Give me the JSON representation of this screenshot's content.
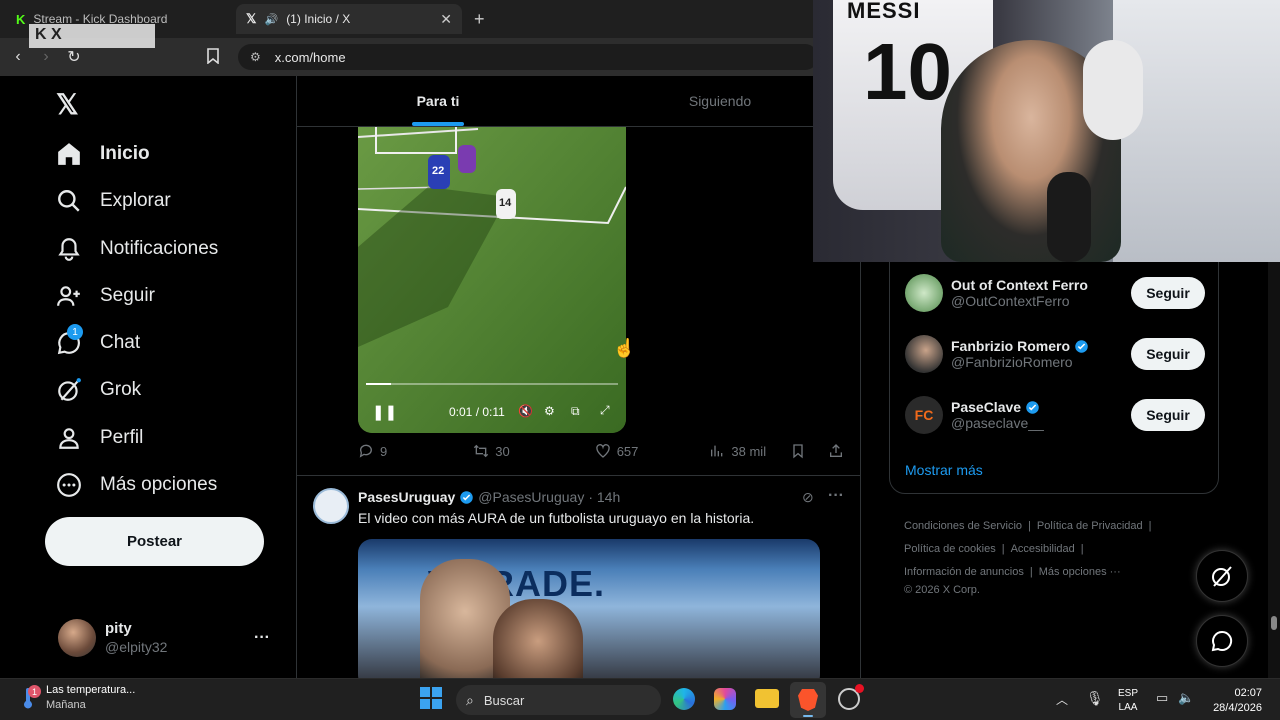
{
  "browser": {
    "tabs": [
      {
        "label": "Stream - Kick Dashboard"
      },
      {
        "label": "(1) Inicio / X"
      }
    ],
    "overlay_logo": "K X",
    "url": "x.com/home"
  },
  "sidebar": {
    "items": [
      {
        "label": "Inicio",
        "icon": "home-icon"
      },
      {
        "label": "Explorar",
        "icon": "search-icon"
      },
      {
        "label": "Notificaciones",
        "icon": "bell-icon"
      },
      {
        "label": "Seguir",
        "icon": "add-user-icon"
      },
      {
        "label": "Chat",
        "icon": "chat-icon",
        "badge": "1"
      },
      {
        "label": "Grok",
        "icon": "grok-icon"
      },
      {
        "label": "Perfil",
        "icon": "profile-icon"
      },
      {
        "label": "Más opciones",
        "icon": "more-circle-icon"
      }
    ],
    "post_label": "Postear",
    "account": {
      "name": "pity",
      "handle": "@elpity32",
      "menu": "···"
    }
  },
  "feed": {
    "tabs": [
      {
        "label": "Para ti"
      },
      {
        "label": "Siguiendo"
      }
    ],
    "video": {
      "time": "0:01 / 0:11",
      "progress": 0.1,
      "jersey_1": "22",
      "jersey_2": "14"
    },
    "tweet1_actions": {
      "replies": "9",
      "retweets": "30",
      "likes": "657",
      "views": "38 mil"
    },
    "tweet2": {
      "author": "PasesUruguay",
      "handle": "@PasesUruguay",
      "time": "· 14h",
      "text": "El video con más AURA de un futbolista uruguayo en la historia.",
      "media_text": "WERADE."
    }
  },
  "who_to_follow": {
    "items": [
      {
        "name": "Out of Context Ferro",
        "handle": "@OutContextFerro",
        "verified": false,
        "button": "Seguir"
      },
      {
        "name": "Fanbrizio Romero",
        "handle": "@FanbrizioRomero",
        "verified": true,
        "button": "Seguir"
      },
      {
        "name": "PaseClave",
        "handle": "@paseclave__",
        "verified": true,
        "button": "Seguir"
      }
    ],
    "show_more": "Mostrar más"
  },
  "footer": {
    "links": [
      "Condiciones de Servicio",
      "Política de Privacidad",
      "Política de cookies",
      "Accesibilidad",
      "Información de anuncios",
      "Más opciones ···"
    ],
    "copyright": "© 2026 X Corp."
  },
  "webcam": {
    "jersey_name": "MESSI",
    "jersey_number": "10"
  },
  "taskbar": {
    "weather_text": "Las temperatura...",
    "weather_sub": "Mañana",
    "weather_badge": "1",
    "search_placeholder": "Buscar",
    "lang_1": "ESP",
    "lang_2": "LAA",
    "time": "02:07",
    "date": "28/4/2026"
  },
  "colors": {
    "accent": "#1d9bf0",
    "background": "#000000",
    "border": "#2f3336",
    "muted": "#71767b"
  }
}
